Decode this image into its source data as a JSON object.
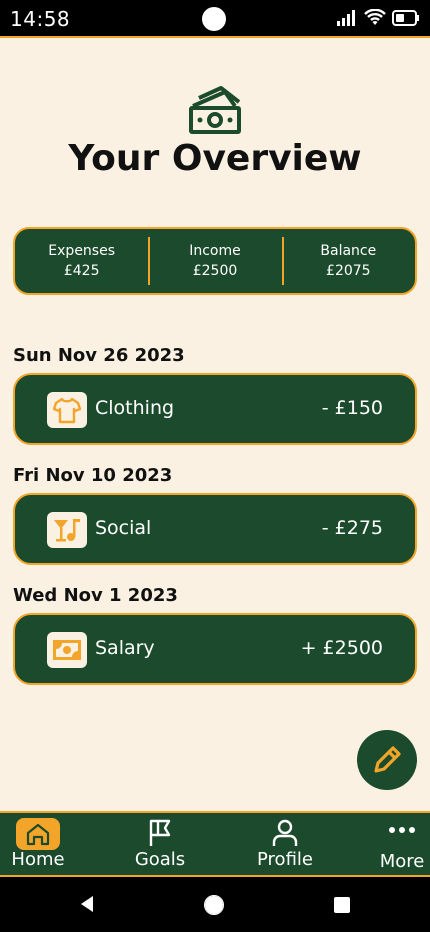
{
  "status_bar": {
    "time": "14:58"
  },
  "header": {
    "title": "Your Overview",
    "icon": "money-icon"
  },
  "summary": {
    "expenses_label": "Expenses",
    "expenses_value": "£425",
    "income_label": "Income",
    "income_value": "£2500",
    "balance_label": "Balance",
    "balance_value": "£2075"
  },
  "transactions": [
    {
      "date": "Sun Nov 26 2023",
      "name": "Clothing",
      "amount": "- £150",
      "icon": "shirt-icon"
    },
    {
      "date": "Fri Nov 10 2023",
      "name": "Social",
      "amount": "- £275",
      "icon": "drinks-icon"
    },
    {
      "date": "Wed Nov 1 2023",
      "name": "Salary",
      "amount": "+ £2500",
      "icon": "banknote-icon"
    }
  ],
  "nav": {
    "home": "Home",
    "goals": "Goals",
    "profile": "Profile",
    "more": "More"
  },
  "colors": {
    "background": "#faf1e3",
    "primary": "#1b4b2c",
    "accent": "#f3a529"
  }
}
